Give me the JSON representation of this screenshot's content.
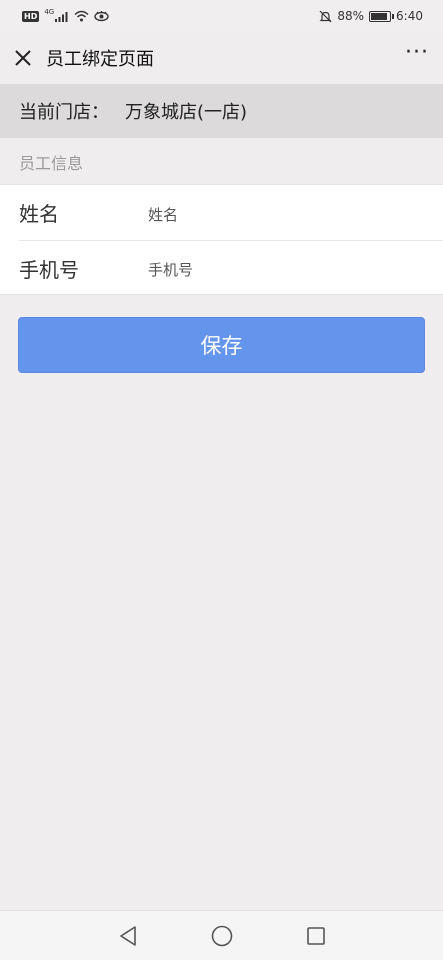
{
  "status_bar": {
    "hd": "HD",
    "network": "4G",
    "battery_percent": "88%",
    "time": "6:40"
  },
  "title_bar": {
    "title": "员工绑定页面",
    "more": "···"
  },
  "store": {
    "label": "当前门店：",
    "name": "万象城店(一店)"
  },
  "section": {
    "title": "员工信息"
  },
  "form": {
    "name_label": "姓名",
    "name_placeholder": "姓名",
    "phone_label": "手机号",
    "phone_placeholder": "手机号"
  },
  "actions": {
    "save_label": "保存"
  },
  "icons": {
    "close": "close-icon",
    "more": "more-icon",
    "back": "back-icon",
    "home": "home-icon",
    "recents": "recents-icon"
  },
  "colors": {
    "primary": "#6495ed",
    "background": "#efedee",
    "store_bar": "#dcdadb"
  }
}
